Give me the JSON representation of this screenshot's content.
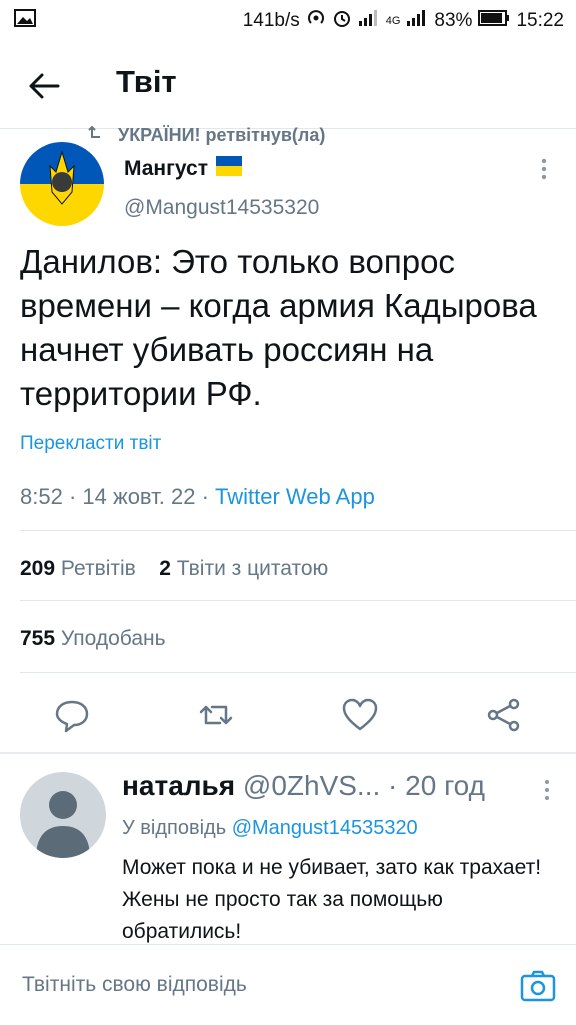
{
  "status_bar": {
    "speed": "141b/s",
    "network": "4G",
    "battery": "83%",
    "time": "15:22"
  },
  "header": {
    "title": "Твіт"
  },
  "tweet": {
    "retweet_label": "УКРАЇНИ! ретвітнув(ла)",
    "author_name": "Мангуст",
    "author_handle": "@Mangust14535320",
    "text": "Данилов: Это только вопрос времени – когда армия Кадырова начнет убивать россиян на территории РФ.",
    "translate_label": "Перекласти твіт",
    "time": "8:52",
    "date": "14 жовт. 22",
    "app": "Twitter Web App",
    "retweets_count": "209",
    "retweets_label": "Ретвітів",
    "quotes_count": "2",
    "quotes_label": "Твіти з цитатою",
    "likes_count": "755",
    "likes_label": "Уподобань"
  },
  "reply": {
    "name": "наталья",
    "handle": "@0ZhVS...",
    "age": "20 год",
    "reply_to_label": "У відповідь",
    "reply_to_handle": "@Mangust14535320",
    "text": "Может пока и не убивает, зато как трахает! Жены не просто так за помощью обратились!"
  },
  "composer": {
    "placeholder": "Твітніть свою відповідь"
  },
  "colors": {
    "accent": "#1b95e0",
    "muted": "#657786",
    "text": "#0f1419",
    "flag_blue": "#0057b7",
    "flag_yellow": "#ffd700"
  }
}
